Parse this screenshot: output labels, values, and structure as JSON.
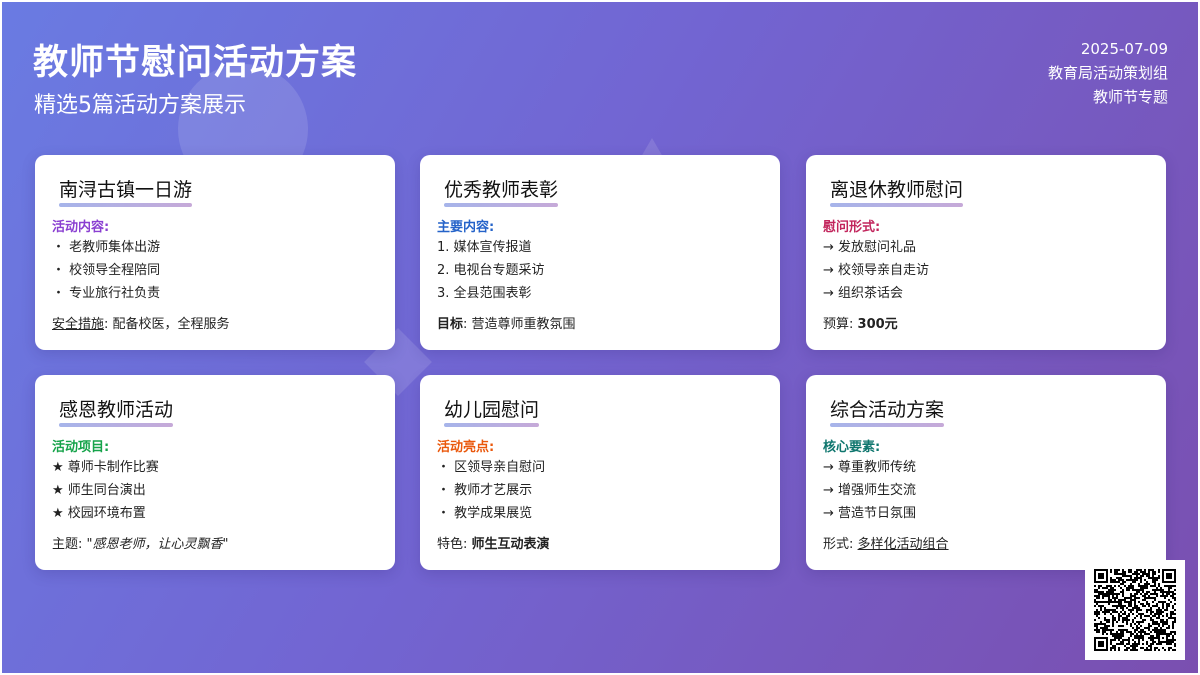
{
  "header": {
    "title": "教师节慰问活动方案",
    "subtitle": "精选5篇活动方案展示",
    "date": "2025-07-09",
    "org": "教育局活动策划组",
    "topic": "教师节专题"
  },
  "colors": {
    "purple": "#8a3fd1",
    "blue": "#2563c9",
    "pink": "#c2255c",
    "green": "#16a34a",
    "orange": "#ea580c",
    "teal": "#0f766e"
  },
  "cards": [
    {
      "title": "南浔古镇一日游",
      "label": "活动内容:",
      "items": [
        "・ 老教师集体出游",
        "・ 校领导全程陪同",
        "・ 专业旅行社负责"
      ],
      "footer_key": "安全措施",
      "footer_sep": ":",
      "footer_value": "配备校医，全程服务"
    },
    {
      "title": "优秀教师表彰",
      "label": "主要内容:",
      "items": [
        "1. 媒体宣传报道",
        "2. 电视台专题采访",
        "3. 全县范围表彰"
      ],
      "footer_key": "目标",
      "footer_sep": ":",
      "footer_value": "营造尊师重教氛围"
    },
    {
      "title": "离退休教师慰问",
      "label": "慰问形式:",
      "items": [
        "→ 发放慰问礼品",
        "→ 校领导亲自走访",
        "→ 组织茶话会"
      ],
      "footer_key": "预算",
      "footer_sep": ":",
      "footer_value": "300元"
    },
    {
      "title": "感恩教师活动",
      "label": "活动项目:",
      "items": [
        "★ 尊师卡制作比赛",
        "★ 师生同台演出",
        "★ 校园环境布置"
      ],
      "footer_key": "主题",
      "footer_sep": ":",
      "footer_value": "\"感恩老师，让心灵飘香\""
    },
    {
      "title": "幼儿园慰问",
      "label": "活动亮点:",
      "items": [
        "・ 区领导亲自慰问",
        "・ 教师才艺展示",
        "・ 教学成果展览"
      ],
      "footer_key": "特色",
      "footer_sep": ":",
      "footer_value": "师生互动表演"
    },
    {
      "title": "综合活动方案",
      "label": "核心要素:",
      "items": [
        "→ 尊重教师传统",
        "→ 增强师生交流",
        "→ 营造节日氛围"
      ],
      "footer_key": "形式",
      "footer_sep": ":",
      "footer_value": "多样化活动组合"
    }
  ]
}
